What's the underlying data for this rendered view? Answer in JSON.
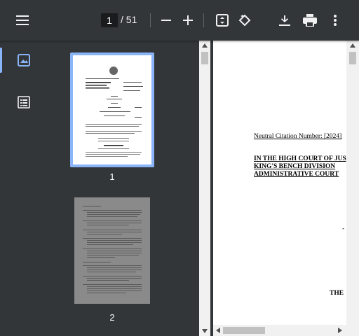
{
  "toolbar": {
    "current_page": "1",
    "total_pages": "/ 51",
    "icons": [
      "menu-icon",
      "zoom-out-icon",
      "zoom-in-icon",
      "fit-page-icon",
      "rotate-icon",
      "download-icon",
      "print-icon",
      "more-vert-icon"
    ]
  },
  "sidebar": {
    "thumbnails": [
      {
        "label": "1",
        "selected": true
      },
      {
        "label": "2",
        "selected": false
      }
    ]
  },
  "document": {
    "citation": "Neutral Citation Number: [2024]",
    "court_line1": "IN THE HIGH COURT OF JUS",
    "court_line2": "KING'S BENCH DIVISION",
    "court_line3": "ADMINISTRATIVE COURT",
    "fragment_dash": "-",
    "fragment_the": "THE"
  },
  "colors": {
    "toolbar_bg": "#323639",
    "accent": "#8ab4f8",
    "viewer_bg": "#525659"
  }
}
